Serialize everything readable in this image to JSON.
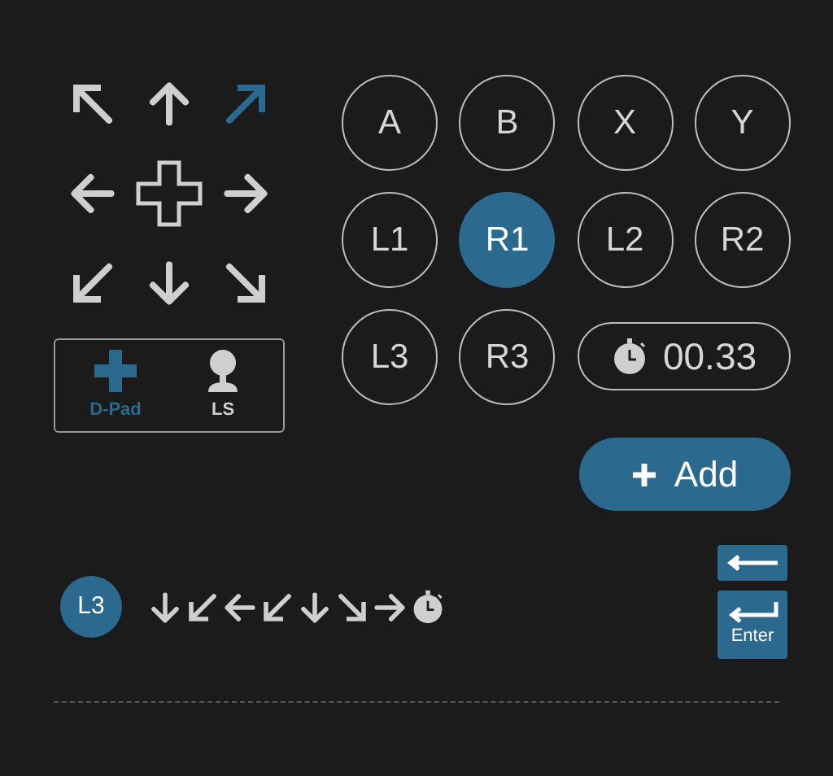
{
  "dpad": {
    "directions": [
      {
        "kind": "up-left",
        "selected": false
      },
      {
        "kind": "up",
        "selected": false
      },
      {
        "kind": "up-right",
        "selected": true
      },
      {
        "kind": "left",
        "selected": false
      },
      {
        "kind": "right",
        "selected": false
      },
      {
        "kind": "down-left",
        "selected": false
      },
      {
        "kind": "down",
        "selected": false
      },
      {
        "kind": "down-right",
        "selected": false
      }
    ]
  },
  "modes": [
    {
      "label": "D-Pad",
      "kind": "dpad",
      "selected": true
    },
    {
      "label": "LS",
      "kind": "stick",
      "selected": false
    }
  ],
  "buttons": [
    {
      "label": "A",
      "selected": false
    },
    {
      "label": "B",
      "selected": false
    },
    {
      "label": "X",
      "selected": false
    },
    {
      "label": "Y",
      "selected": false
    },
    {
      "label": "L1",
      "selected": false
    },
    {
      "label": "R1",
      "selected": true
    },
    {
      "label": "L2",
      "selected": false
    },
    {
      "label": "R2",
      "selected": false
    },
    {
      "label": "L3",
      "selected": false
    },
    {
      "label": "R3",
      "selected": false
    }
  ],
  "timer": {
    "value": "00.33"
  },
  "add_button": {
    "label": "Add"
  },
  "sequence": [
    {
      "kind": "button",
      "label": "L3"
    },
    {
      "kind": "down"
    },
    {
      "kind": "down-left"
    },
    {
      "kind": "left"
    },
    {
      "kind": "down-left"
    },
    {
      "kind": "down"
    },
    {
      "kind": "down-right"
    },
    {
      "kind": "right"
    },
    {
      "kind": "timer"
    }
  ],
  "keys": [
    {
      "kind": "backspace"
    },
    {
      "kind": "enter",
      "label": "Enter"
    }
  ]
}
